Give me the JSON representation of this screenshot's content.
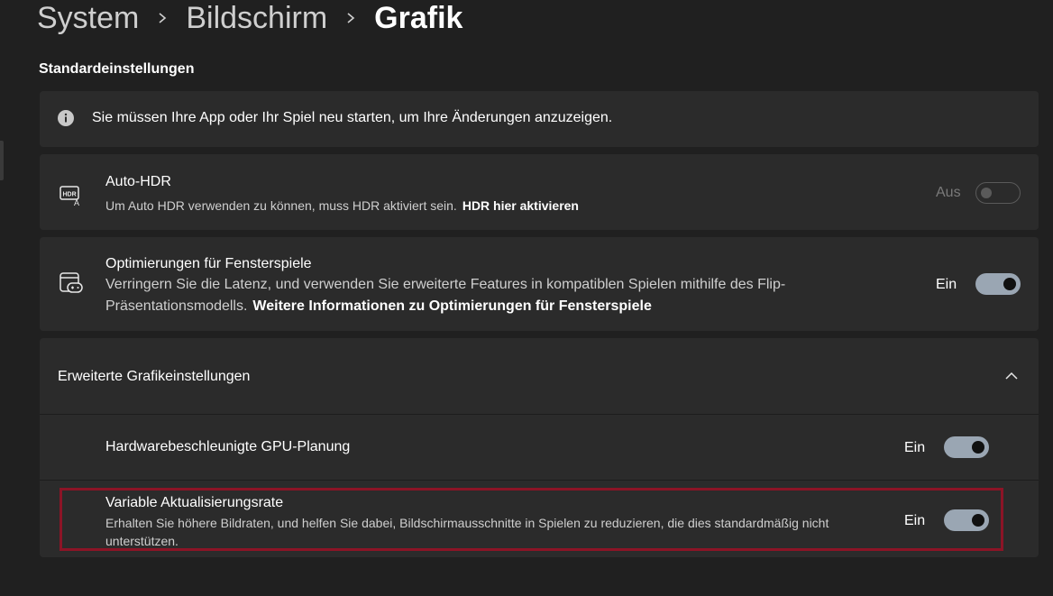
{
  "breadcrumb": {
    "item1": "System",
    "item2": "Bildschirm",
    "current": "Grafik"
  },
  "section": {
    "label": "Standardeinstellungen"
  },
  "info": {
    "text": "Sie müssen Ihre App oder Ihr Spiel neu starten, um Ihre Änderungen anzuzeigen."
  },
  "auto_hdr": {
    "title": "Auto-HDR",
    "desc": "Um Auto HDR verwenden zu können, muss HDR aktiviert sein.",
    "link": "HDR hier aktivieren",
    "state": "Aus",
    "on": false
  },
  "window_games": {
    "title": "Optimierungen für Fensterspiele",
    "desc": "Verringern Sie die Latenz, und verwenden Sie erweiterte Features in kompatiblen Spielen mithilfe des Flip-Präsentationsmodells.",
    "link": "Weitere Informationen zu Optimierungen für Fensterspiele",
    "state": "Ein",
    "on": true
  },
  "advanced": {
    "title": "Erweiterte Grafikeinstellungen",
    "gpu": {
      "title": "Hardwarebeschleunigte GPU-Planung",
      "state": "Ein",
      "on": true
    },
    "vrr": {
      "title": "Variable Aktualisierungsrate",
      "desc": "Erhalten Sie höhere Bildraten, und helfen Sie dabei, Bildschirmausschnitte in Spielen zu reduzieren, die dies standardmäßig nicht unterstützen.",
      "state": "Ein",
      "on": true
    }
  },
  "colors": {
    "background": "#202020",
    "card": "#2b2b2b",
    "toggle_on": "#9aa6b3",
    "highlight": "#8c1426"
  }
}
